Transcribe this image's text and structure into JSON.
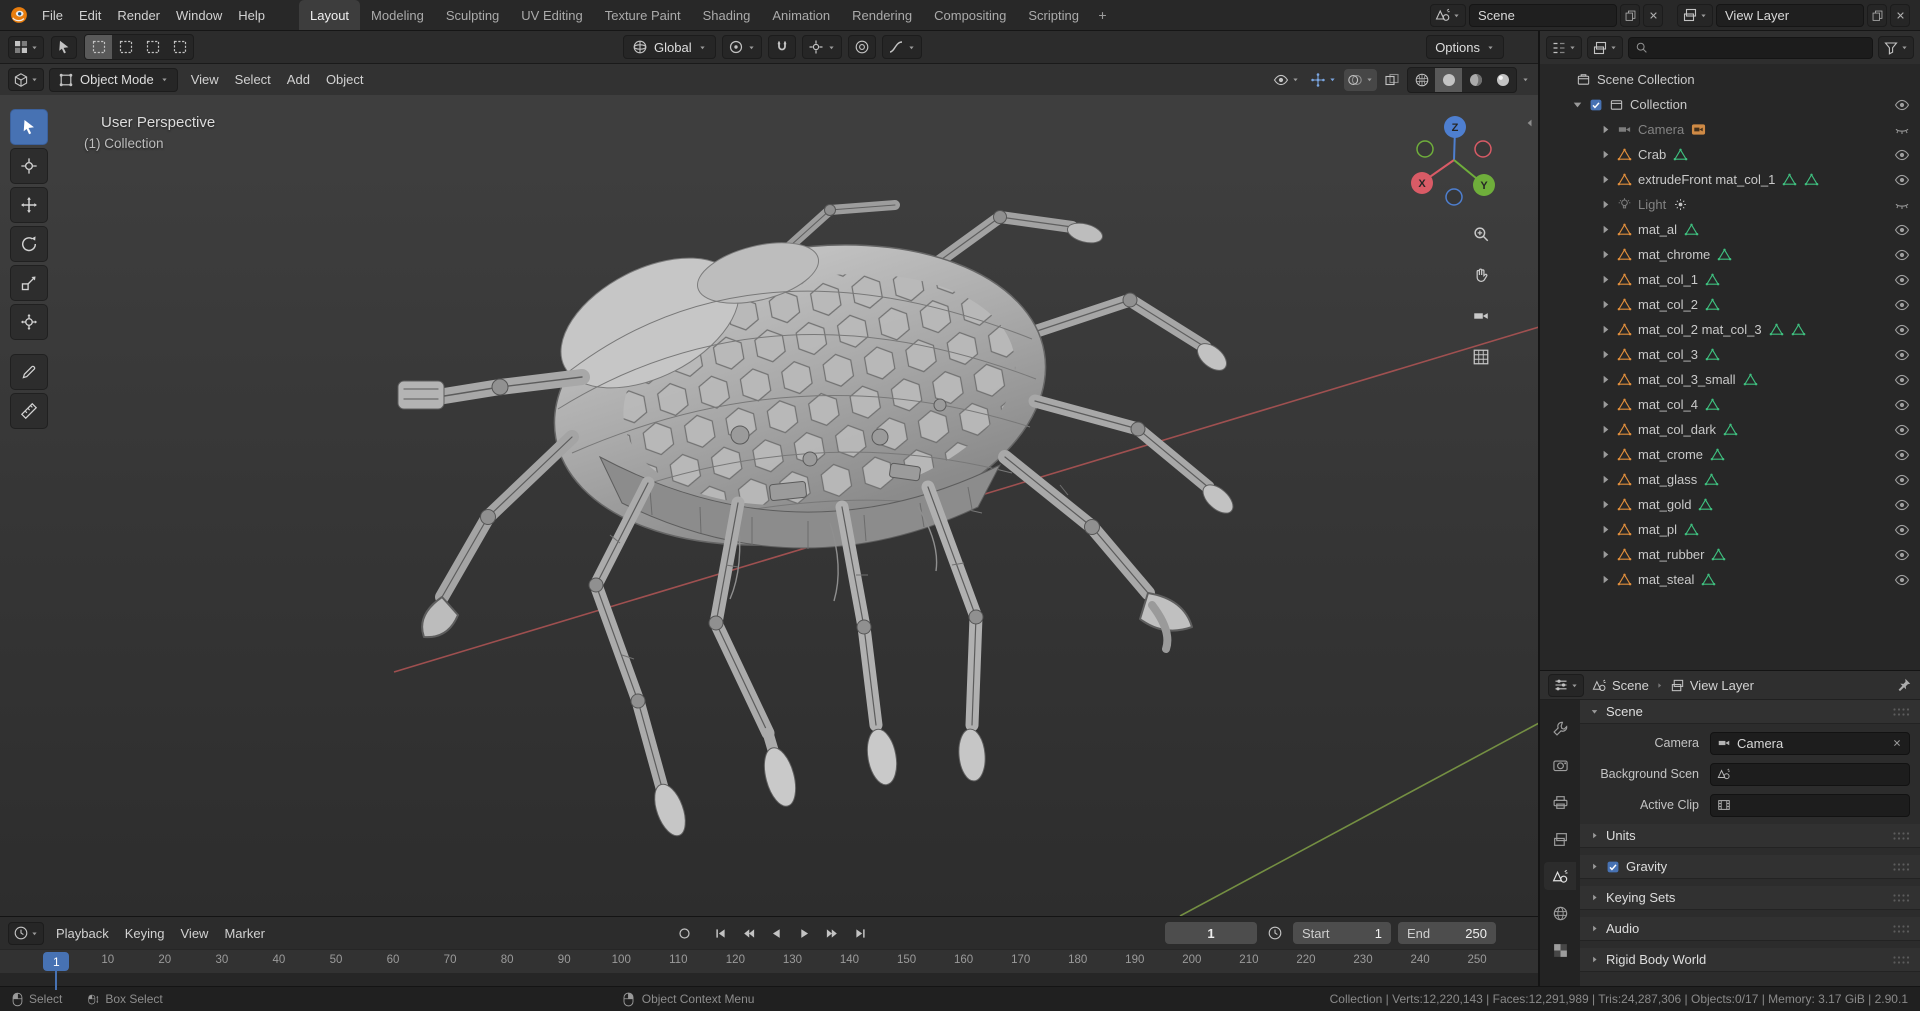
{
  "topbar": {
    "menus": [
      "File",
      "Edit",
      "Render",
      "Window",
      "Help"
    ],
    "workspaces": [
      "Layout",
      "Modeling",
      "Sculpting",
      "UV Editing",
      "Texture Paint",
      "Shading",
      "Animation",
      "Rendering",
      "Compositing",
      "Scripting"
    ],
    "active_workspace": "Layout",
    "scene_selector": {
      "value": "Scene"
    },
    "view_layer_selector": {
      "value": "View Layer"
    }
  },
  "tool_settings": {
    "transform_orientation": "Global",
    "options_label": "Options"
  },
  "viewport": {
    "mode": "Object Mode",
    "menus": [
      "View",
      "Select",
      "Add",
      "Object"
    ],
    "overlay_line1": "User Perspective",
    "overlay_line2": "(1) Collection",
    "gizmo": {
      "x": "X",
      "y": "Y",
      "z": "Z"
    },
    "tools": [
      {
        "name": "tweak-select-tool",
        "icon": "cursor-arrow-icon",
        "active": true
      },
      {
        "name": "cursor-tool",
        "icon": "cursor-3d-icon"
      },
      {
        "name": "move-tool",
        "icon": "move-icon"
      },
      {
        "name": "rotate-tool",
        "icon": "rotate-icon"
      },
      {
        "name": "scale-tool",
        "icon": "scale-icon"
      },
      {
        "name": "transform-tool",
        "icon": "transform-icon"
      },
      {
        "name": "annotate-tool",
        "icon": "annotate-icon",
        "gap": true
      },
      {
        "name": "measure-tool",
        "icon": "measure-icon"
      }
    ],
    "shading_modes": [
      {
        "name": "wireframe",
        "icon": "shade-wireframe-icon"
      },
      {
        "name": "solid",
        "icon": "shade-solid-icon",
        "active": true
      },
      {
        "name": "material-preview",
        "icon": "shade-material-icon"
      },
      {
        "name": "rendered",
        "icon": "shade-rendered-icon"
      }
    ]
  },
  "outliner": {
    "root_label": "Scene Collection",
    "collection_label": "Collection",
    "items": [
      {
        "name": "Camera",
        "icon": "camera-icon",
        "dim": true,
        "data_badge": "camera-data-icon",
        "eye": "closed"
      },
      {
        "name": "Crab",
        "icon": "object-mesh-icon",
        "badges": 1,
        "eye": "open"
      },
      {
        "name": "extrudeFront mat_col_1",
        "icon": "object-mesh-icon",
        "badges": 2,
        "eye": "open"
      },
      {
        "name": "Light",
        "icon": "light-icon",
        "dim": true,
        "data_badge": "light-data-icon",
        "eye": "closed"
      },
      {
        "name": "mat_al",
        "icon": "object-mesh-icon",
        "badges": 1,
        "eye": "open"
      },
      {
        "name": "mat_chrome",
        "icon": "object-mesh-icon",
        "badges": 1,
        "eye": "open"
      },
      {
        "name": "mat_col_1",
        "icon": "object-mesh-icon",
        "badges": 1,
        "eye": "open"
      },
      {
        "name": "mat_col_2",
        "icon": "object-mesh-icon",
        "badges": 1,
        "eye": "open"
      },
      {
        "name": "mat_col_2 mat_col_3",
        "icon": "object-mesh-icon",
        "badges": 2,
        "eye": "open"
      },
      {
        "name": "mat_col_3",
        "icon": "object-mesh-icon",
        "badges": 1,
        "eye": "open"
      },
      {
        "name": "mat_col_3_small",
        "icon": "object-mesh-icon",
        "badges": 1,
        "eye": "open"
      },
      {
        "name": "mat_col_4",
        "icon": "object-mesh-icon",
        "badges": 1,
        "eye": "open"
      },
      {
        "name": "mat_col_dark",
        "icon": "object-mesh-icon",
        "badges": 1,
        "eye": "open"
      },
      {
        "name": "mat_crome",
        "icon": "object-mesh-icon",
        "badges": 1,
        "eye": "open"
      },
      {
        "name": "mat_glass",
        "icon": "object-mesh-icon",
        "badges": 1,
        "eye": "open"
      },
      {
        "name": "mat_gold",
        "icon": "object-mesh-icon",
        "badges": 1,
        "eye": "open"
      },
      {
        "name": "mat_pl",
        "icon": "object-mesh-icon",
        "badges": 1,
        "eye": "open"
      },
      {
        "name": "mat_rubber",
        "icon": "object-mesh-icon",
        "badges": 1,
        "eye": "open"
      },
      {
        "name": "mat_steal",
        "icon": "object-mesh-icon",
        "badges": 1,
        "eye": "open"
      }
    ]
  },
  "properties": {
    "breadcrumb": [
      {
        "label": "Scene",
        "icon": "scene-breadcrumb-icon"
      },
      {
        "label": "View Layer",
        "icon": "view-layer-icon"
      }
    ],
    "tabs": [
      {
        "name": "tool",
        "icon": "tool-tab-icon"
      },
      {
        "name": "render",
        "icon": "render-tab-icon"
      },
      {
        "name": "output",
        "icon": "output-tab-icon"
      },
      {
        "name": "view-layer",
        "icon": "view-layer-tab-icon"
      },
      {
        "name": "scene",
        "icon": "scene-tab-icon",
        "active": true
      },
      {
        "name": "world",
        "icon": "world-tab-icon"
      },
      {
        "name": "texture",
        "icon": "texture-tab-icon"
      }
    ],
    "scene_panel": {
      "title": "Scene",
      "fields": [
        {
          "label": "Camera",
          "icon": "camera-icon",
          "value": "Camera",
          "clearable": true
        },
        {
          "label": "Background Scen",
          "icon": "scene-breadcrumb-icon",
          "value": ""
        },
        {
          "label": "Active Clip",
          "icon": "clip-icon",
          "value": ""
        }
      ]
    },
    "sections": [
      {
        "label": "Units"
      },
      {
        "label": "Gravity",
        "checkbox": true
      },
      {
        "label": "Keying Sets"
      },
      {
        "label": "Audio"
      },
      {
        "label": "Rigid Body World"
      }
    ]
  },
  "timeline": {
    "menus": [
      "Playback",
      "Keying",
      "View",
      "Marker"
    ],
    "transport": [
      "jump-to-start",
      "previous-keyframe",
      "play-reverse",
      "play",
      "next-keyframe",
      "jump-to-end"
    ],
    "current_frame": "1",
    "playhead_frame": 1,
    "start": {
      "label": "Start",
      "value": "1"
    },
    "end": {
      "label": "End",
      "value": "250"
    },
    "frame_ticks": [
      10,
      20,
      30,
      40,
      50,
      60,
      70,
      80,
      90,
      100,
      110,
      120,
      130,
      140,
      150,
      160,
      170,
      180,
      190,
      200,
      210,
      220,
      230,
      240,
      250
    ]
  },
  "statusbar": {
    "hints": [
      {
        "icon": "mouse-left-icon",
        "label": "Select"
      },
      {
        "icon": "mouse-drag-icon",
        "label": "Box Select"
      },
      {
        "icon": "mouse-right-icon",
        "label": "Object Context Menu",
        "wide_gap": true
      }
    ],
    "stats": "Collection | Verts:12,220,143 | Faces:12,291,989 | Tris:24,287,306 | Objects:0/17 | Memory: 3.17 GiB | 2.90.1"
  }
}
